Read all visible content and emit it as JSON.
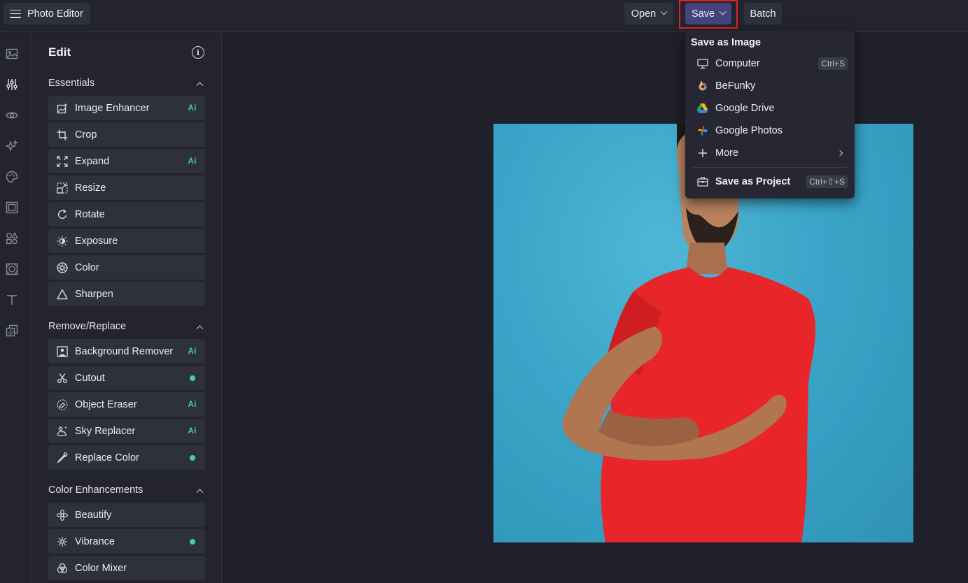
{
  "app": {
    "title": "Photo Editor"
  },
  "toolbar": {
    "open_label": "Open",
    "save_label": "Save",
    "batch_label": "Batch"
  },
  "rail_icons": [
    "image-icon",
    "sliders-icon",
    "eye-icon",
    "sparkle-icon",
    "palette-icon",
    "frame-icon",
    "shapes-icon",
    "texture-icon",
    "text-icon",
    "layers-icon"
  ],
  "panel": {
    "title": "Edit",
    "sections": [
      {
        "title": "Essentials",
        "tools": [
          {
            "label": "Image Enhancer",
            "badge": "Ai"
          },
          {
            "label": "Crop"
          },
          {
            "label": "Expand",
            "badge": "Ai"
          },
          {
            "label": "Resize"
          },
          {
            "label": "Rotate"
          },
          {
            "label": "Exposure"
          },
          {
            "label": "Color"
          },
          {
            "label": "Sharpen"
          }
        ]
      },
      {
        "title": "Remove/Replace",
        "tools": [
          {
            "label": "Background Remover",
            "badge": "Ai"
          },
          {
            "label": "Cutout",
            "dot": true
          },
          {
            "label": "Object Eraser",
            "badge": "Ai"
          },
          {
            "label": "Sky Replacer",
            "badge": "Ai"
          },
          {
            "label": "Replace Color",
            "dot": true
          }
        ]
      },
      {
        "title": "Color Enhancements",
        "tools": [
          {
            "label": "Beautify"
          },
          {
            "label": "Vibrance",
            "dot": true
          },
          {
            "label": "Color Mixer"
          }
        ]
      }
    ]
  },
  "save_menu": {
    "heading": "Save as Image",
    "items": [
      {
        "label": "Computer",
        "shortcut": "Ctrl+S",
        "icon": "monitor-icon"
      },
      {
        "label": "BeFunky",
        "icon": "befunky-logo-icon"
      },
      {
        "label": "Google Drive",
        "icon": "google-drive-icon"
      },
      {
        "label": "Google Photos",
        "icon": "google-photos-icon"
      },
      {
        "label": "More",
        "icon": "plus-icon"
      }
    ],
    "project": {
      "label": "Save as Project",
      "shortcut": "Ctrl+⇧+S",
      "icon": "briefcase-icon"
    }
  },
  "colors": {
    "accent_ai": "#3fd0b0",
    "save_button": "#43437e",
    "highlight": "#e02424",
    "photo_bg": "#3aa5c8",
    "shirt": "#e8262a"
  }
}
